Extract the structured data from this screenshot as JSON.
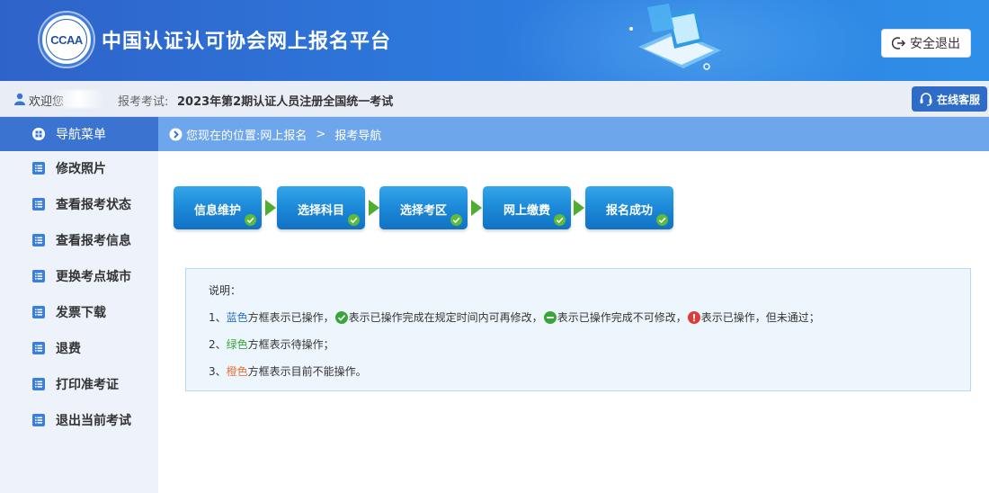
{
  "header": {
    "logo_text": "CCAA",
    "site_title": "中国认证认可协会网上报名平台",
    "logout_label": "安全退出"
  },
  "infobar": {
    "welcome": "欢迎您",
    "exam_label": "报考考试:",
    "exam_name": "2023年第2期认证人员注册全国统一考试",
    "service_label": "在线客服"
  },
  "sidebar": {
    "header_label": "导航菜单",
    "items": [
      {
        "label": "修改照片"
      },
      {
        "label": "查看报考状态"
      },
      {
        "label": "查看报考信息"
      },
      {
        "label": "更换考点城市"
      },
      {
        "label": "发票下载"
      },
      {
        "label": "退费"
      },
      {
        "label": "打印准考证"
      },
      {
        "label": "退出当前考试"
      }
    ]
  },
  "breadcrumb": {
    "prefix": "您现在的位置:",
    "items": [
      "网上报名",
      "报考导航"
    ],
    "separator": ">"
  },
  "steps": [
    {
      "label": "信息维护",
      "status": "done"
    },
    {
      "label": "选择科目",
      "status": "done"
    },
    {
      "label": "选择考区",
      "status": "done"
    },
    {
      "label": "网上缴费",
      "status": "done"
    },
    {
      "label": "报名成功",
      "status": "done"
    }
  ],
  "description": {
    "title": "说明：",
    "line1": {
      "prefix": "1、",
      "color_word": "蓝色",
      "text1": "方框表示已操作，",
      "text2": "表示已操作完成在规定时间内可再修改，",
      "text3": "表示已操作完成不可修改，",
      "text4": "表示已操作，但未通过；"
    },
    "line2": {
      "prefix": "2、",
      "color_word": "绿色",
      "text": "方框表示待操作；"
    },
    "line3": {
      "prefix": "3、",
      "color_word": "橙色",
      "text": "方框表示目前不能操作。"
    }
  },
  "colors": {
    "header_blue": "#2f78dc",
    "nav_active": "#3b74d0",
    "breadcrumb": "#6da6ea",
    "step_blue": "#1a86d6",
    "ok_green": "#3aa53a",
    "error_red": "#e03a3a",
    "orange": "#e8743a"
  }
}
